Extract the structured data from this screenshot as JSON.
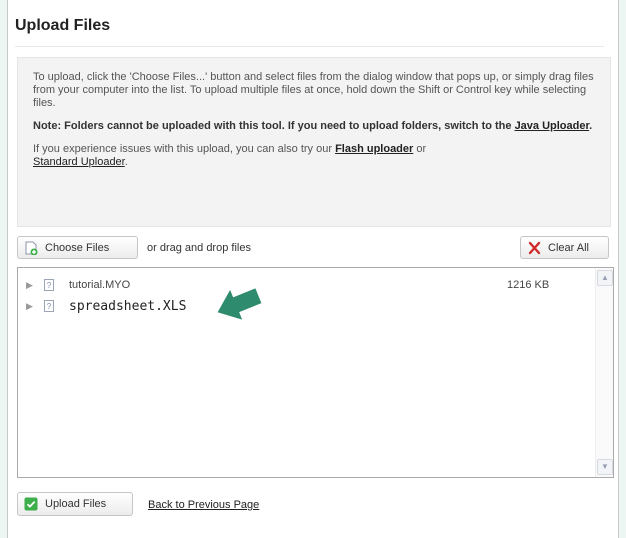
{
  "dialog": {
    "title": "Upload Files",
    "info": {
      "para1": "To upload, click the 'Choose Files...' button and select files from the dialog window that pops up, or simply drag files from your computer into the list. To upload multiple files at once, hold down the Shift or Control key while selecting files.",
      "note_text": "Note: Folders cannot be uploaded with this tool. If you need to upload folders, switch to the ",
      "note_link": "Java Uploader",
      "note_end": ".",
      "para3_text": "If you experience issues with this upload, you can also try our ",
      "flash_link": "Flash uploader",
      "para3_or": " or",
      "standard_link": "Standard Uploader",
      "para3_end": "."
    },
    "toolbar": {
      "choose_label": "Choose Files",
      "drop_hint": "or drag and drop files",
      "clear_label": "Clear All"
    },
    "files": [
      {
        "name": "tutorial.MYO",
        "size": "1216 KB",
        "icon": "?"
      },
      {
        "name": "spreadsheet.XLS",
        "size": "",
        "icon": "?"
      }
    ],
    "footer": {
      "upload_label": "Upload Files",
      "back_link": "Back to Previous Page"
    }
  },
  "colors": {
    "arrow": "#2e8b6e",
    "upload_icon": "#3cae4a",
    "clear_icon": "#d02a2a"
  }
}
